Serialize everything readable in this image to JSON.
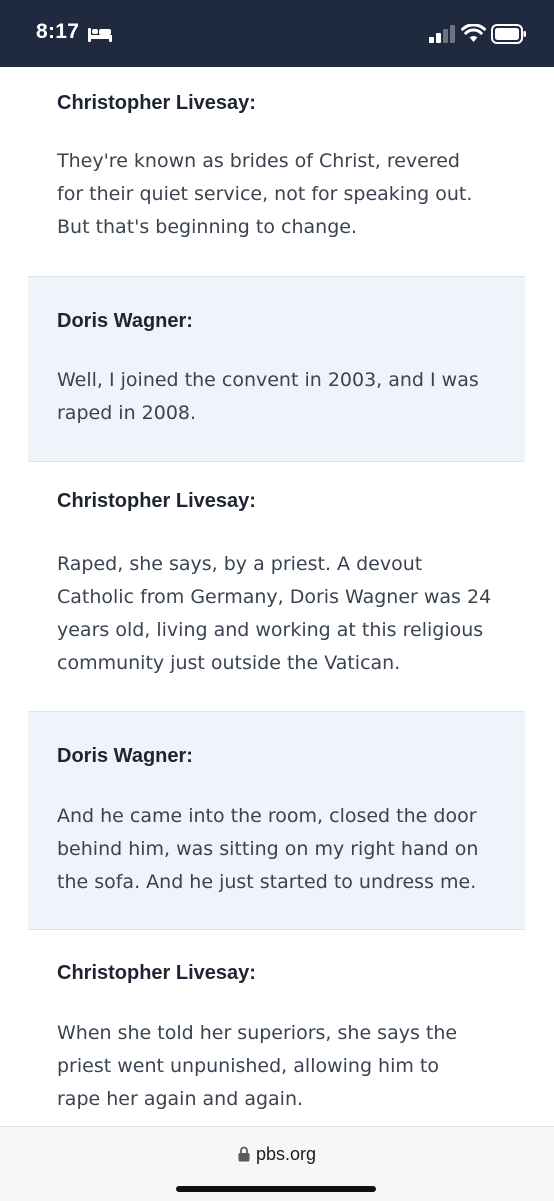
{
  "status_bar": {
    "time": "8:17",
    "focus_icon": "bed-icon",
    "signal_icon": "cellular-signal-icon",
    "wifi_icon": "wifi-icon",
    "battery_icon": "battery-icon",
    "background": "#1f2a3e"
  },
  "transcript": [
    {
      "speaker": "Christopher Livesay:",
      "lines": [
        "They're known as brides of Christ, revered",
        "for their quiet service, not for speaking out.",
        "But that's beginning to change."
      ],
      "shaded": false
    },
    {
      "speaker": "Doris Wagner:",
      "lines": [
        "Well, I joined the convent in 2003, and I was",
        "raped in 2008."
      ],
      "shaded": true
    },
    {
      "speaker": "Christopher Livesay:",
      "lines": [
        "Raped, she says, by a priest. A devout",
        "Catholic from Germany, Doris Wagner was 24",
        "years old, living and working at this religious",
        "community just outside the Vatican."
      ],
      "shaded": false
    },
    {
      "speaker": "Doris Wagner:",
      "lines": [
        "And he came into the room, closed the door",
        "behind him, was sitting on my right hand on",
        "the sofa. And he just started to undress me."
      ],
      "shaded": true
    },
    {
      "speaker": "Christopher Livesay:",
      "lines": [
        "When she told her superiors, she says the",
        "priest went unpunished, allowing him to",
        "rape her again and again."
      ],
      "shaded": false
    }
  ],
  "colors": {
    "shaded_block": "#eef4fa",
    "divider": "#dce4ec",
    "speaker_text": "#1e2431",
    "body_text": "#3a4350"
  },
  "browser_bar": {
    "lock_icon": "lock-icon",
    "url": "pbs.org"
  }
}
